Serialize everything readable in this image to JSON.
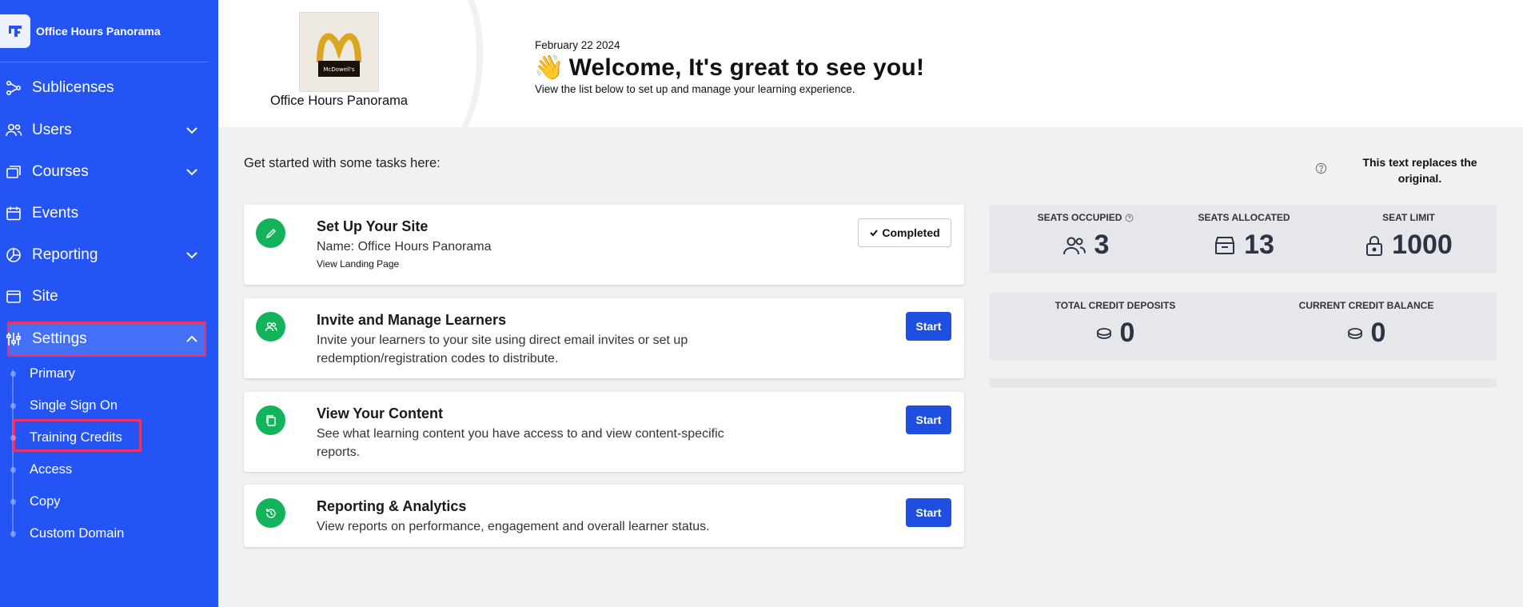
{
  "sidebar": {
    "brand": "Office Hours Panorama",
    "items": [
      {
        "label": "Sublicenses"
      },
      {
        "label": "Users"
      },
      {
        "label": "Courses"
      },
      {
        "label": "Events"
      },
      {
        "label": "Reporting"
      },
      {
        "label": "Site"
      },
      {
        "label": "Settings"
      }
    ],
    "settings_sub": [
      {
        "label": "Primary"
      },
      {
        "label": "Single Sign On"
      },
      {
        "label": "Training Credits"
      },
      {
        "label": "Access"
      },
      {
        "label": "Copy"
      },
      {
        "label": "Custom Domain"
      }
    ]
  },
  "header": {
    "org_name": "Office Hours Panorama",
    "logo_text": "McDowell's",
    "date": "February 22 2024",
    "welcome": "Welcome, It's great to see you!",
    "subtitle": "View the list below to set up and manage your learning experience."
  },
  "main": {
    "tasks_heading": "Get started with some tasks here:",
    "replace_text": "This text replaces the original.",
    "tasks": [
      {
        "title": "Set Up Your Site",
        "desc": "Name: Office Hours Panorama",
        "link": "View Landing Page",
        "action": "Completed"
      },
      {
        "title": "Invite and Manage Learners",
        "desc": "Invite your learners to your site using direct email invites or set up redemption/registration codes to distribute.",
        "action": "Start"
      },
      {
        "title": "View Your Content",
        "desc": "See what learning content you have access to and view content-specific reports.",
        "action": "Start"
      },
      {
        "title": "Reporting & Analytics",
        "desc": "View reports on performance, engagement and overall learner status.",
        "action": "Start"
      }
    ],
    "stats": {
      "seats_occupied": {
        "label": "SEATS OCCUPIED",
        "value": "3"
      },
      "seats_allocated": {
        "label": "SEATS ALLOCATED",
        "value": "13"
      },
      "seat_limit": {
        "label": "SEAT LIMIT",
        "value": "1000"
      },
      "total_credit": {
        "label": "TOTAL CREDIT DEPOSITS",
        "value": "0"
      },
      "current_credit": {
        "label": "CURRENT CREDIT BALANCE",
        "value": "0"
      }
    }
  },
  "colors": {
    "sidebar": "#2554f5",
    "accent": "#1f4fe0",
    "success": "#13b35c",
    "highlight": "#e8336d"
  }
}
